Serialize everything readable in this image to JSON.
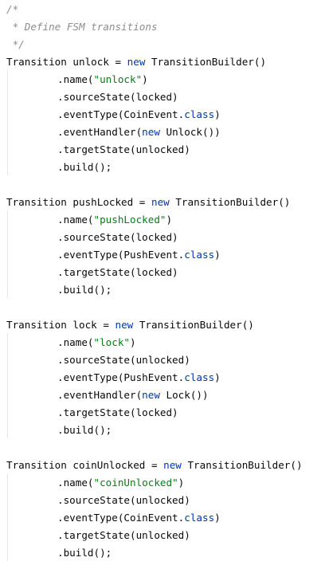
{
  "editor": {
    "blocks": [
      {
        "comment": [
          "/*",
          " * Define FSM transitions",
          " */"
        ]
      },
      {
        "decl": {
          "pre": "Transition unlock = ",
          "kw": "new",
          "post": " TransitionBuilder()"
        },
        "calls": [
          {
            "pre": ".name(",
            "str": "\"unlock\"",
            "post": ")"
          },
          {
            "pre": ".sourceState(locked)"
          },
          {
            "pre": ".eventType(CoinEvent.",
            "kw": "class",
            "post": ")"
          },
          {
            "pre": ".eventHandler(",
            "kw": "new",
            "post": " Unlock())"
          },
          {
            "pre": ".targetState(unlocked)"
          },
          {
            "pre": ".build();"
          }
        ]
      },
      {
        "decl": {
          "pre": "Transition pushLocked = ",
          "kw": "new",
          "post": " TransitionBuilder()"
        },
        "calls": [
          {
            "pre": ".name(",
            "str": "\"pushLocked\"",
            "post": ")"
          },
          {
            "pre": ".sourceState(locked)"
          },
          {
            "pre": ".eventType(PushEvent.",
            "kw": "class",
            "post": ")"
          },
          {
            "pre": ".targetState(locked)"
          },
          {
            "pre": ".build();"
          }
        ]
      },
      {
        "decl": {
          "pre": "Transition lock = ",
          "kw": "new",
          "post": " TransitionBuilder()"
        },
        "calls": [
          {
            "pre": ".name(",
            "str": "\"lock\"",
            "post": ")"
          },
          {
            "pre": ".sourceState(unlocked)"
          },
          {
            "pre": ".eventType(PushEvent.",
            "kw": "class",
            "post": ")"
          },
          {
            "pre": ".eventHandler(",
            "kw": "new",
            "post": " Lock())"
          },
          {
            "pre": ".targetState(locked)"
          },
          {
            "pre": ".build();"
          }
        ]
      },
      {
        "decl": {
          "pre": "Transition coinUnlocked = ",
          "kw": "new",
          "post": " TransitionBuilder()"
        },
        "calls": [
          {
            "pre": ".name(",
            "str": "\"coinUnlocked\"",
            "post": ")"
          },
          {
            "pre": ".sourceState(unlocked)"
          },
          {
            "pre": ".eventType(CoinEvent.",
            "kw": "class",
            "post": ")"
          },
          {
            "pre": ".targetState(unlocked)"
          },
          {
            "pre": ".build();"
          }
        ]
      }
    ]
  },
  "colors": {
    "background": "#ffffff",
    "comment": "#8c8c8c",
    "keyword": "#0033b3",
    "string": "#067d17",
    "text": "#080808",
    "indent_guide": "#e6e6e6"
  }
}
